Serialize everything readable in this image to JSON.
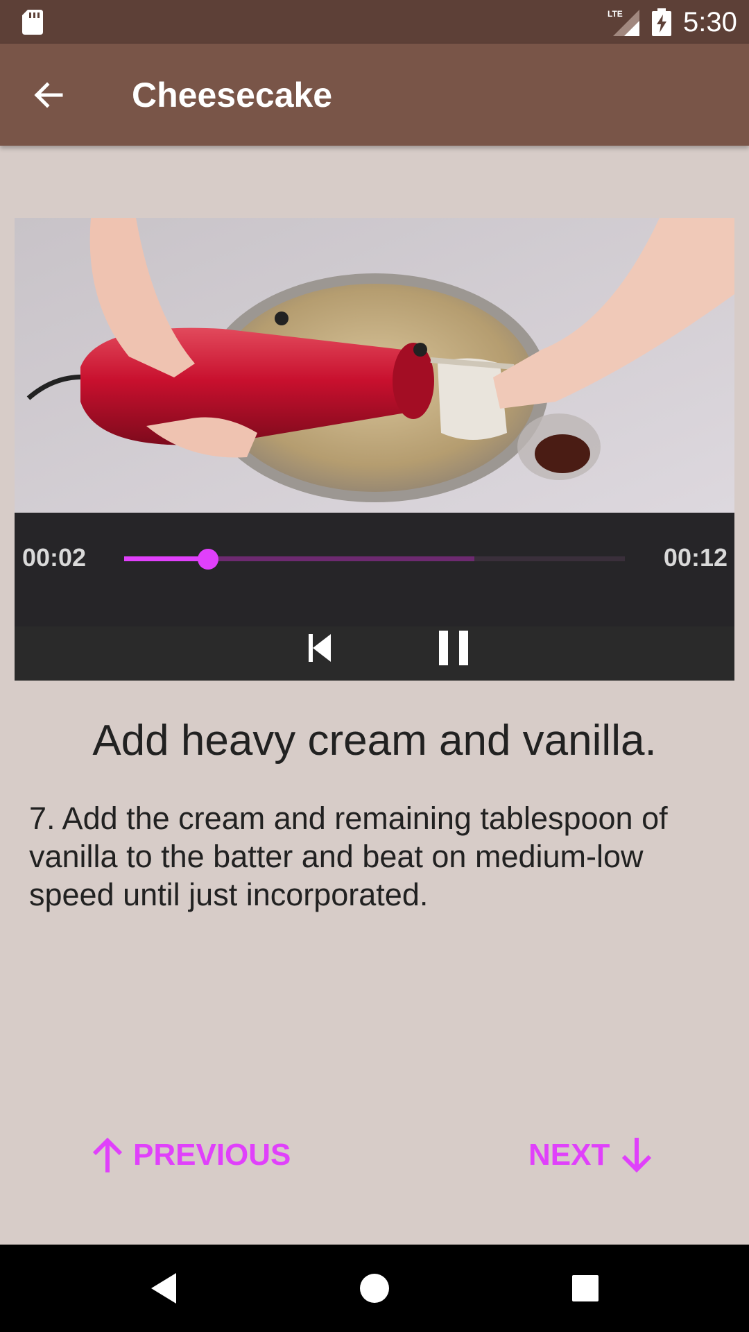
{
  "status_bar": {
    "time": "5:30",
    "network_label": "LTE",
    "icons": [
      "sd-card-icon",
      "lte-signal-icon",
      "battery-charging-icon"
    ]
  },
  "app_bar": {
    "title": "Cheesecake",
    "back_icon": "arrow-back-icon"
  },
  "player": {
    "current_time": "00:02",
    "total_time": "00:12",
    "progress_fraction": 0.167,
    "buffered_fraction": 0.7,
    "controls": [
      "skip-previous-icon",
      "pause-icon"
    ]
  },
  "step": {
    "title": "Add heavy cream and vanilla.",
    "description": "7. Add the cream and remaining tablespoon of vanilla to the batter and beat on medium-low speed until just incorporated."
  },
  "navigation": {
    "previous_label": "PREVIOUS",
    "next_label": "NEXT",
    "accent_color": "#e040fb"
  },
  "colors": {
    "status_bar": "#5d4037",
    "app_bar": "#795548",
    "background": "#d7ccc8"
  }
}
